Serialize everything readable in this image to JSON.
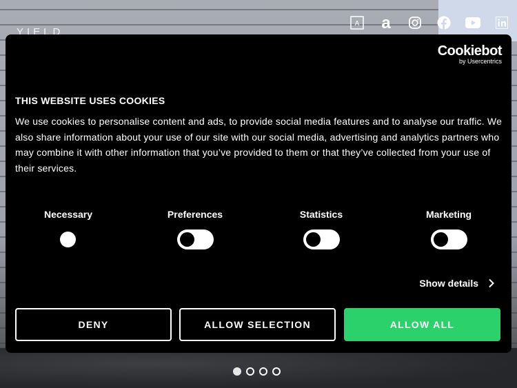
{
  "site": {
    "brand": "YIELD",
    "social_icons": [
      "square-a-icon",
      "amazon-a-icon",
      "instagram-icon",
      "facebook-icon",
      "youtube-icon",
      "linkedin-icon"
    ]
  },
  "cookie_dialog": {
    "logo_main": "Cookiebot",
    "logo_sub": "by Usercentrics",
    "title": "THIS WEBSITE USES COOKIES",
    "description": "We use cookies to personalise content and ads, to provide social media features and to analyse our traffic. We also share information about your use of our site with our social media, advertising and analytics partners who may combine it with other information that you’ve provided to them or that they’ve collected from your use of their services.",
    "categories": [
      {
        "label": "Necessary",
        "state": "locked"
      },
      {
        "label": "Preferences",
        "state": "off"
      },
      {
        "label": "Statistics",
        "state": "off"
      },
      {
        "label": "Marketing",
        "state": "off"
      }
    ],
    "show_details": "Show details",
    "buttons": {
      "deny": "DENY",
      "allow_selection": "ALLOW SELECTION",
      "allow_all": "ALLOW ALL"
    },
    "accent_color": "#2bd16b"
  },
  "carousel": {
    "slide_count": 4,
    "active_slide": 1
  }
}
